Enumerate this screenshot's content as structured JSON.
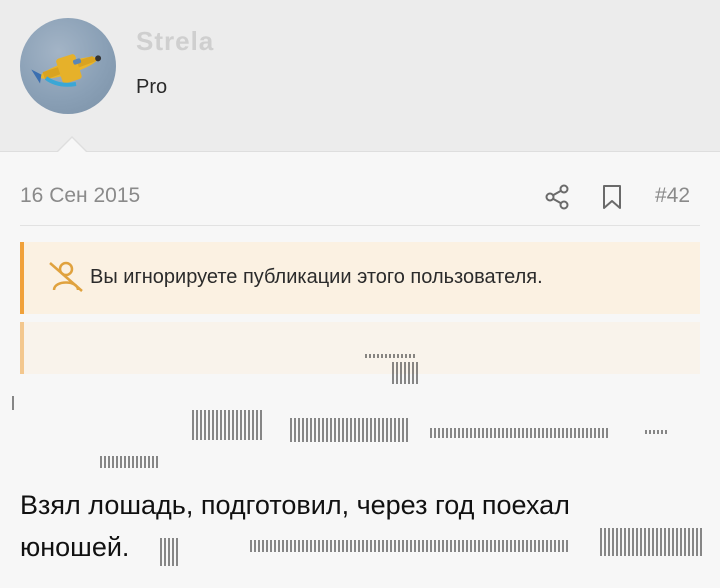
{
  "user": {
    "avatar_icon": "airplane-avatar-icon",
    "username": "Strela",
    "title": "Pro"
  },
  "post": {
    "date": "16 Сен 2015",
    "share_icon": "share-icon",
    "bookmark_icon": "bookmark-icon",
    "number": "#42"
  },
  "ignore_notice": {
    "icon": "muted-user-icon",
    "text": "Вы игнорируете публикации этого пользователя."
  },
  "body": {
    "line1": "Взял лошадь, подготовил, через год поехал",
    "line2": "юношей."
  },
  "colors": {
    "accent": "#f0a13a",
    "notice_bg": "#fbf1e2",
    "muted_text": "#8a8a8a"
  }
}
